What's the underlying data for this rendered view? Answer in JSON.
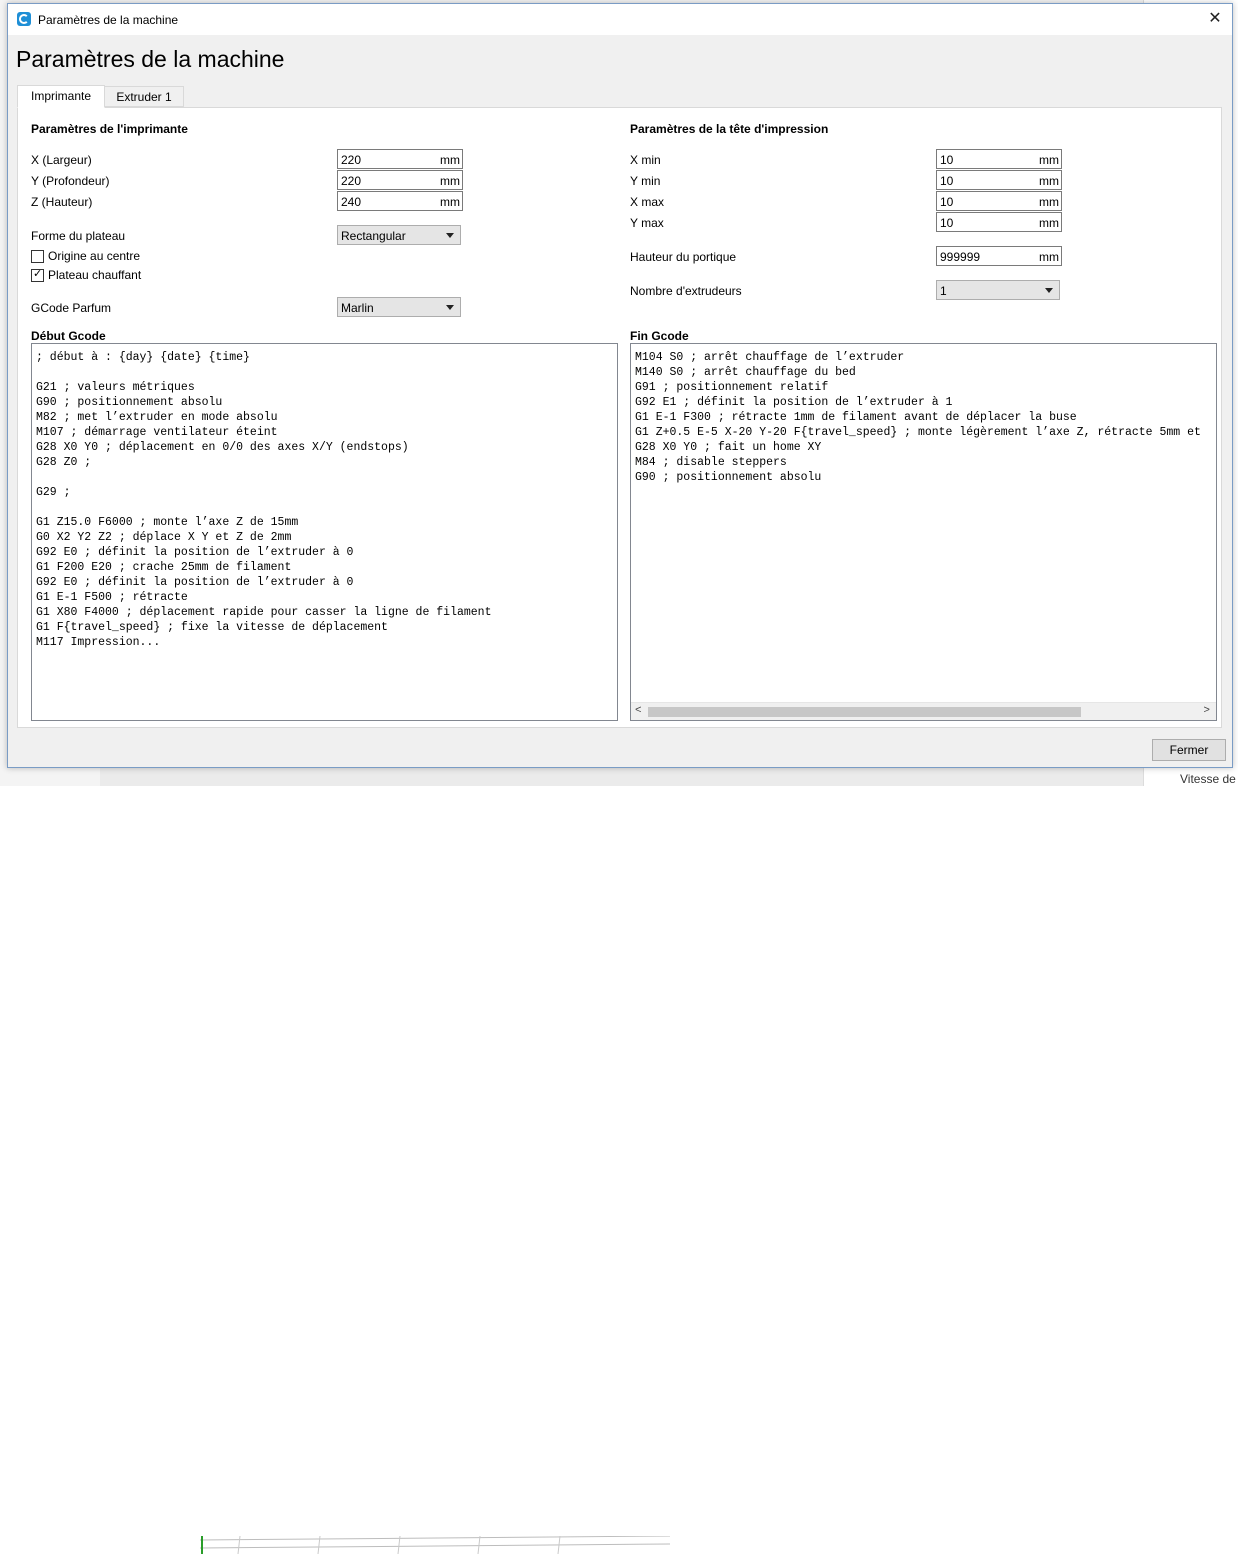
{
  "window": {
    "title": "Paramètres de la machine"
  },
  "page_title": "Paramètres de la machine",
  "tabs": [
    {
      "label": "Imprimante"
    },
    {
      "label": "Extruder 1"
    }
  ],
  "printer": {
    "section_title": "Paramètres de l'imprimante",
    "width_label": "X (Largeur)",
    "width_value": "220",
    "depth_label": "Y (Profondeur)",
    "depth_value": "220",
    "height_label": "Z (Hauteur)",
    "height_value": "240",
    "unit": "mm",
    "bed_shape_label": "Forme du plateau",
    "bed_shape_value": "Rectangular",
    "origin_center_label": "Origine au centre",
    "origin_center_checked": false,
    "heated_bed_label": "Plateau chauffant",
    "heated_bed_checked": true,
    "gcode_flavor_label": "GCode Parfum",
    "gcode_flavor_value": "Marlin"
  },
  "printhead": {
    "section_title": "Paramètres de la tête d'impression",
    "xmin_label": "X min",
    "xmin_value": "10",
    "ymin_label": "Y min",
    "ymin_value": "10",
    "xmax_label": "X max",
    "xmax_value": "10",
    "ymax_label": "Y max",
    "ymax_value": "10",
    "unit": "mm",
    "gantry_label": "Hauteur du portique",
    "gantry_value": "999999",
    "extruders_label": "Nombre d'extrudeurs",
    "extruders_value": "1"
  },
  "start_gcode": {
    "label": "Début Gcode",
    "lines": [
      "; début à : {day} {date} {time}",
      "",
      "G21 ; valeurs métriques",
      "G90 ; positionnement absolu",
      "M82 ; met l’extruder en mode absolu",
      "M107 ; démarrage ventilateur éteint",
      "G28 X0 Y0 ; déplacement en 0/0 des axes X/Y (endstops)",
      "G28 Z0 ;",
      "",
      "G29 ;",
      "",
      "G1 Z15.0 F6000 ; monte l’axe Z de 15mm",
      "G0 X2 Y2 Z2 ; déplace X Y et Z de 2mm",
      "G92 E0 ; définit la position de l’extruder à 0",
      "G1 F200 E20 ; crache 25mm de filament",
      "G92 E0 ; définit la position de l’extruder à 0",
      "G1 E-1 F500 ; rétracte",
      "G1 X80 F4000 ; déplacement rapide pour casser la ligne de filament",
      "G1 F{travel_speed} ; fixe la vitesse de déplacement",
      "M117 Impression..."
    ]
  },
  "end_gcode": {
    "label": "Fin Gcode",
    "lines": [
      "M104 S0 ; arrêt chauffage de l’extruder",
      "M140 S0 ; arrêt chauffage du bed",
      "G91 ; positionnement relatif",
      "G92 E1 ; définit la position de l’extruder à 1",
      "G1 E-1 F300 ; rétracte 1mm de filament avant de déplacer la buse",
      "G1 Z+0.5 E-5 X-20 Y-20 F{travel_speed} ; monte légèrement l’axe Z, rétracte 5mm et",
      "G28 X0 Y0 ; fait un home XY",
      "M84 ; disable steppers",
      "G90 ; positionnement absolu"
    ]
  },
  "close_button_label": "Fermer",
  "background": {
    "bottom_right_text": "Vitesse de"
  },
  "icons": {
    "app": "cura-logo-icon",
    "close": "close-icon",
    "dropdown": "chevron-down-icon"
  },
  "colors": {
    "app_icon": "#1f8fd6",
    "window_border": "#7a9cc5"
  }
}
